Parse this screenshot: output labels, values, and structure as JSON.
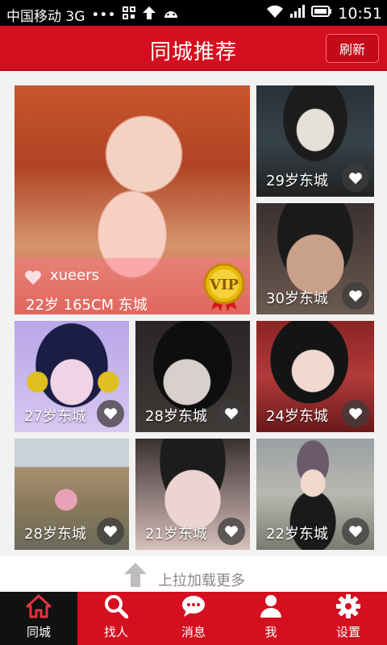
{
  "status_bar": {
    "carrier": "中国移动 3G",
    "dots": "•••",
    "time": "10:51"
  },
  "header": {
    "title": "同城推荐",
    "refresh_label": "刷新"
  },
  "featured": {
    "name": "xueers",
    "details": "22岁 165CM 东城",
    "badge": "VIP"
  },
  "cards": [
    {
      "caption": "29岁东城"
    },
    {
      "caption": "30岁东城"
    },
    {
      "caption": "27岁东城"
    },
    {
      "caption": "28岁东城"
    },
    {
      "caption": "24岁东城"
    },
    {
      "caption": "28岁东城"
    },
    {
      "caption": "21岁东城"
    },
    {
      "caption": "22岁东城"
    }
  ],
  "load_more": "上拉加载更多",
  "nav": {
    "items": [
      {
        "label": "同城",
        "icon": "home-icon"
      },
      {
        "label": "找人",
        "icon": "search-icon"
      },
      {
        "label": "消息",
        "icon": "chat-icon"
      },
      {
        "label": "我",
        "icon": "person-icon"
      },
      {
        "label": "设置",
        "icon": "gear-icon"
      }
    ],
    "active_index": 0
  },
  "colors": {
    "brand_red": "#d40f1f",
    "active_tab": "#111111"
  }
}
